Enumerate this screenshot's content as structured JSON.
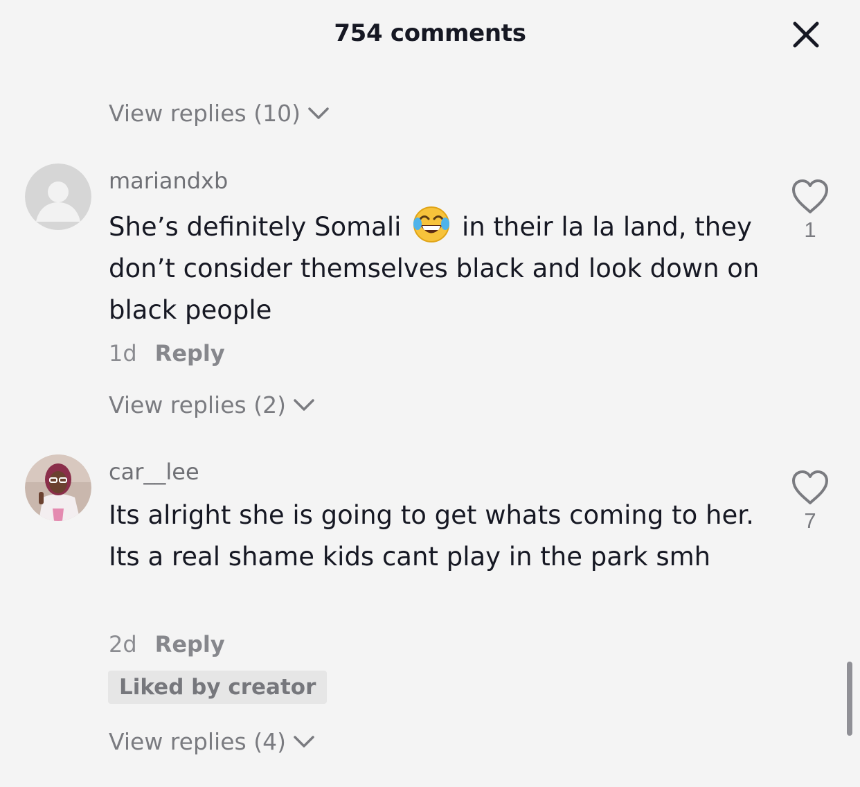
{
  "header": {
    "title": "754 comments"
  },
  "top_thread": {
    "view_replies": "View replies (10)"
  },
  "comments": [
    {
      "username": "mariandxb",
      "text_before_emoji": "She’s definitely Somali",
      "emoji": "face-with-tears-of-joy",
      "text_after_emoji": "in their la la land, they don’t consider themselves black and look down on black people",
      "time": "1d",
      "reply_label": "Reply",
      "like_count": "1",
      "view_replies": "View replies (2)"
    },
    {
      "username": "car__lee",
      "text": "Its alright she is going to get whats coming to her. Its a real shame kids cant play in the park smh",
      "time": "2d",
      "reply_label": "Reply",
      "badge": "Liked by creator",
      "like_count": "7",
      "view_replies": "View replies (4)"
    }
  ],
  "colors": {
    "background": "#f4f4f4",
    "text_primary": "#161823",
    "text_secondary": "#7a7b80",
    "badge_bg": "#e6e6e6"
  }
}
